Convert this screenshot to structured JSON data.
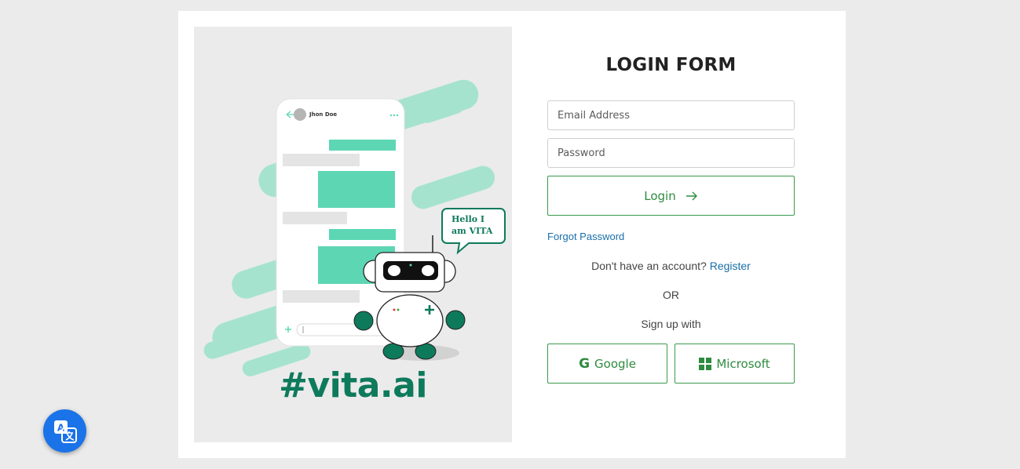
{
  "illustration": {
    "brand_text": "#vita.ai",
    "phone_contact_name": "Jhon Doe",
    "robot_speech": "Hello I\nam VITA",
    "accent_color": "#5dd6b4",
    "brand_color": "#0e7a5c"
  },
  "form": {
    "title": "LOGIN FORM",
    "email_placeholder": "Email Address",
    "password_placeholder": "Password",
    "login_label": "Login",
    "forgot_password": "Forgot Password",
    "no_account_text": "Don't have an account?",
    "register_link": "Register",
    "or_text": "OR",
    "signup_with": "Sign up with",
    "google_label": "Google",
    "microsoft_label": "Microsoft",
    "primary_color": "#2e8b3f",
    "link_color": "#1a6ea8"
  },
  "icons": {
    "arrow": "arrow-right-icon",
    "google": "google-icon",
    "microsoft": "microsoft-icon",
    "translate": "translate-icon"
  }
}
